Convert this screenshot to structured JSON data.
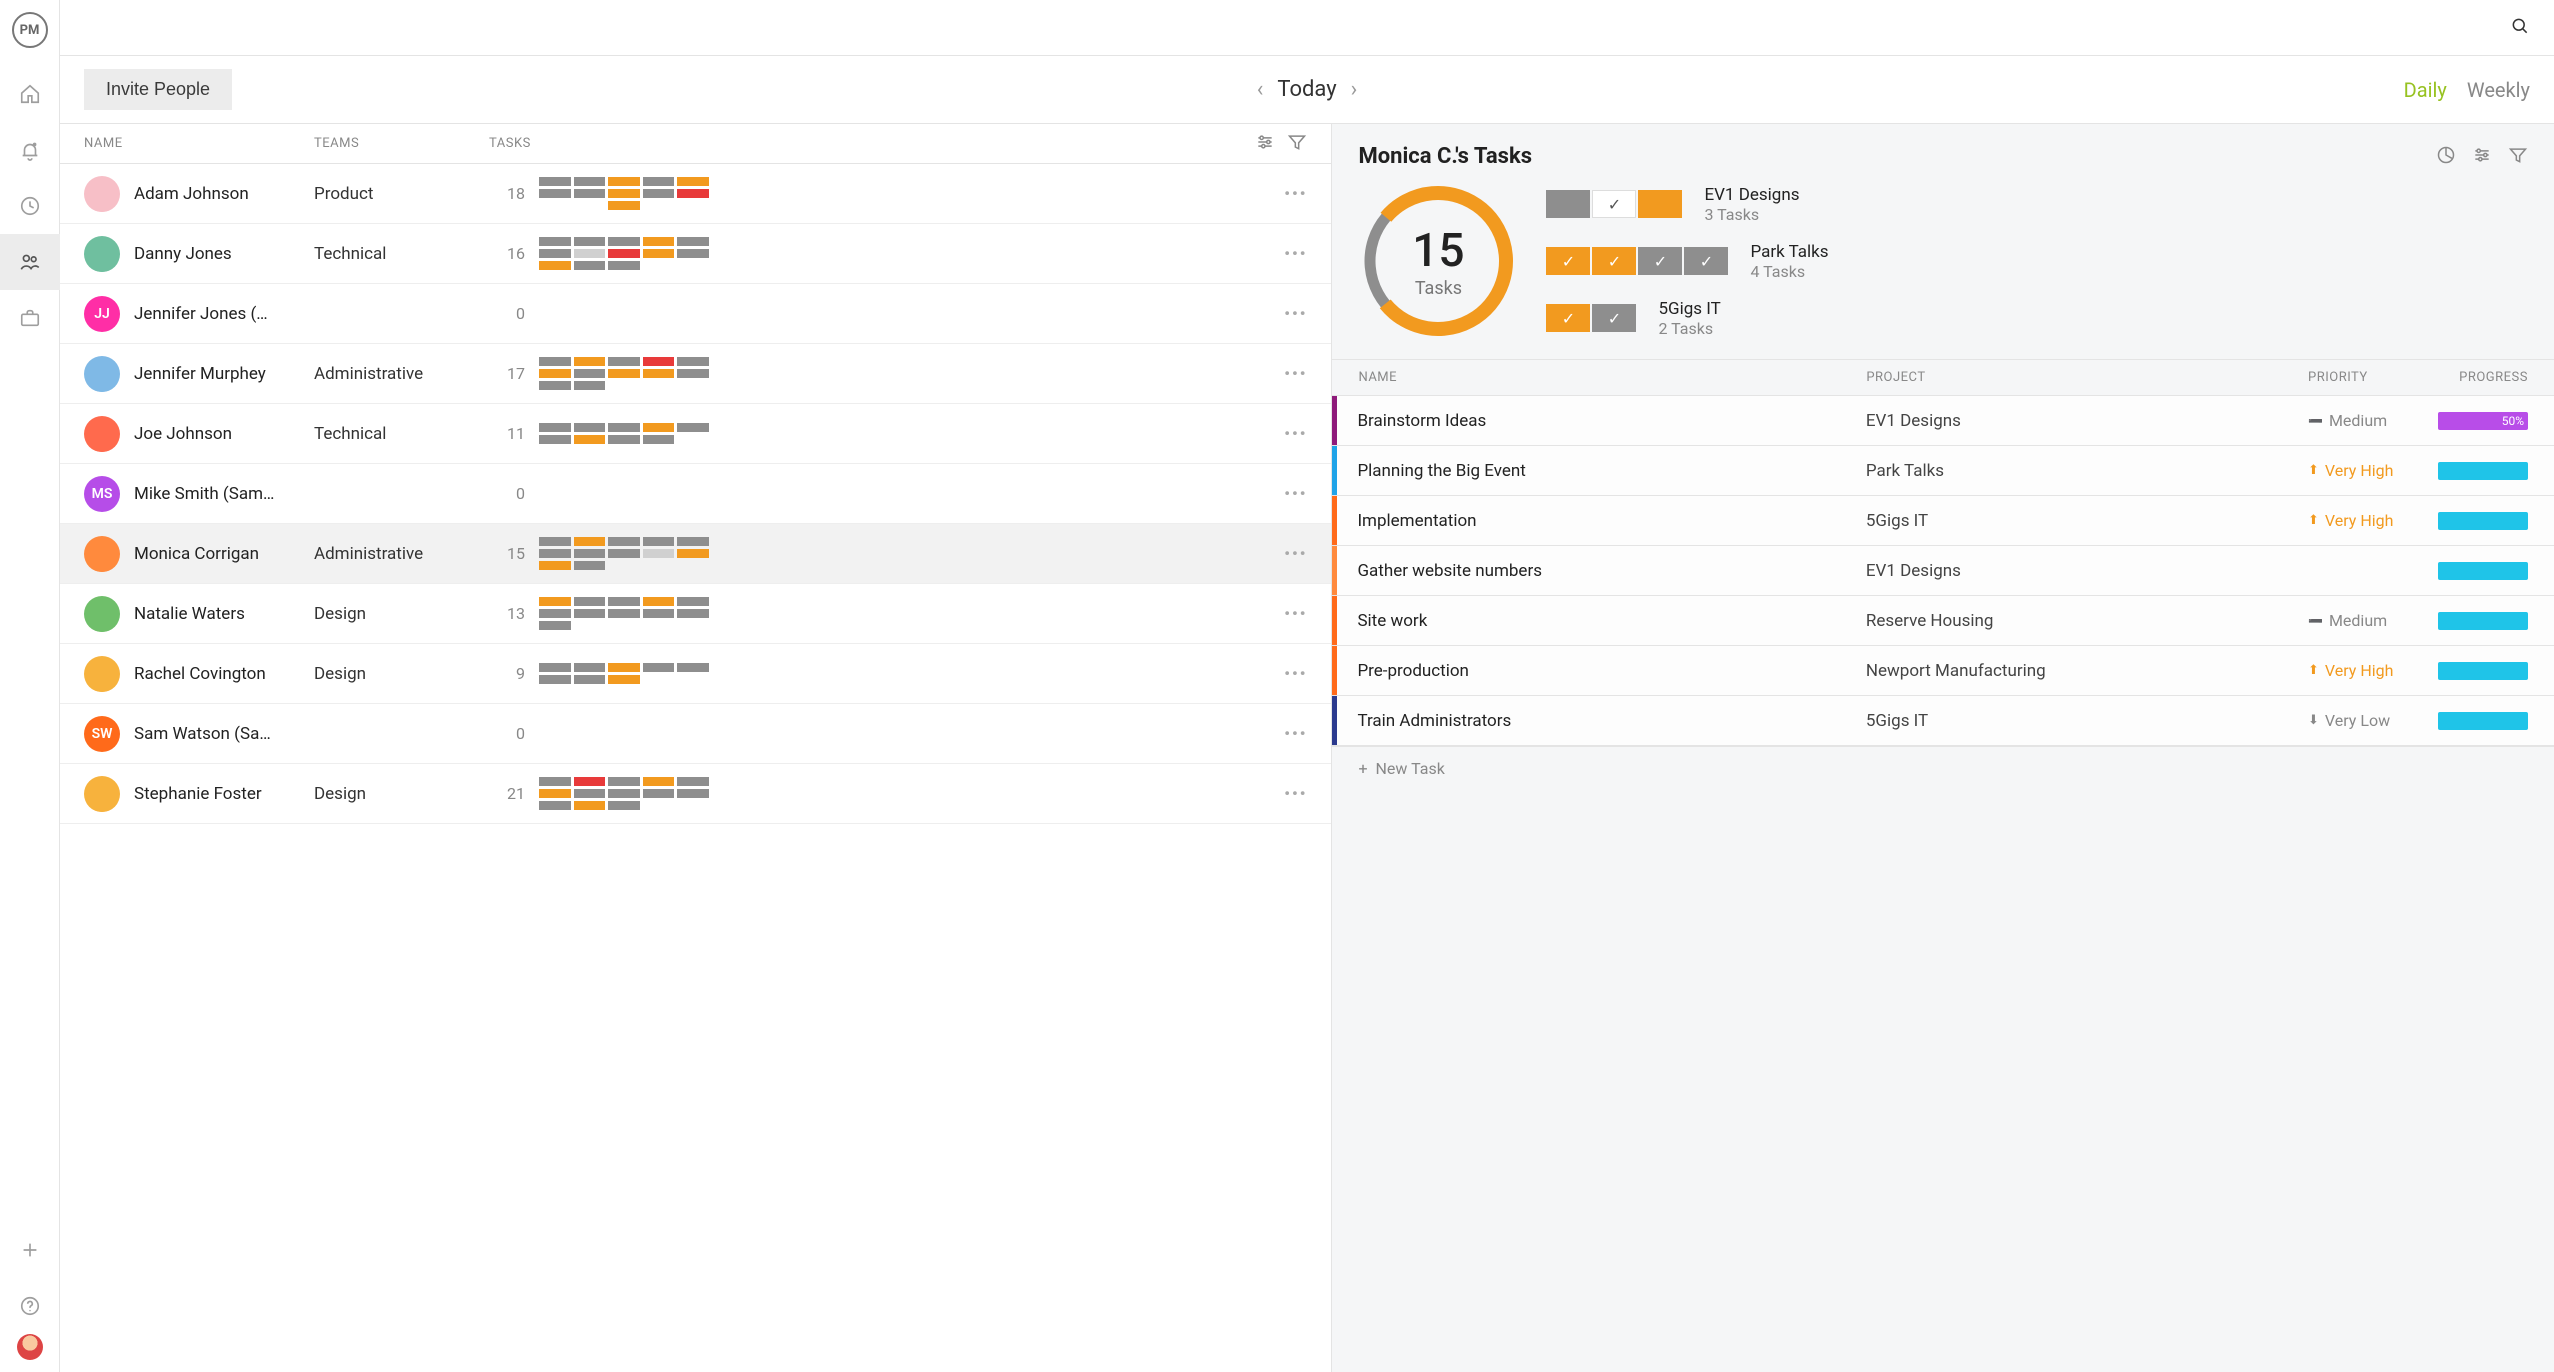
{
  "brand": "PM",
  "header": {
    "invite_label": "Invite People",
    "today_label": "Today",
    "daily_label": "Daily",
    "weekly_label": "Weekly"
  },
  "columns": {
    "name": "NAME",
    "teams": "TEAMS",
    "tasks": "TASKS"
  },
  "people": [
    {
      "name": "Adam Johnson",
      "team": "Product",
      "count": 18,
      "avatar_bg": "#f7bfc7",
      "bars": [
        [
          "",
          "",
          "o",
          "",
          "o"
        ],
        [
          "",
          "",
          "o",
          "",
          "r"
        ],
        [
          "e",
          "e",
          "o",
          "e",
          "e"
        ]
      ]
    },
    {
      "name": "Danny Jones",
      "team": "Technical",
      "count": 16,
      "avatar_bg": "#6fbf9f",
      "bars": [
        [
          "",
          "",
          "",
          "o",
          ""
        ],
        [
          "",
          "g",
          "r",
          "o",
          ""
        ],
        [
          "o",
          "",
          "",
          "e",
          "e"
        ]
      ]
    },
    {
      "name": "Jennifer Jones (…",
      "team": "",
      "count": 0,
      "avatar_bg": "#ff2ea6",
      "initials": "JJ",
      "bars": []
    },
    {
      "name": "Jennifer Murphey",
      "team": "Administrative",
      "count": 17,
      "avatar_bg": "#7fb9e6",
      "bars": [
        [
          "",
          "o",
          "",
          "r",
          ""
        ],
        [
          "o",
          "",
          "o",
          "o",
          ""
        ],
        [
          "",
          "",
          "e",
          "e",
          "e"
        ]
      ]
    },
    {
      "name": "Joe Johnson",
      "team": "Technical",
      "count": 11,
      "avatar_bg": "#ff6a4d",
      "bars": [
        [
          "",
          "",
          "",
          "o",
          ""
        ],
        [
          "",
          "o",
          "",
          "",
          "e"
        ]
      ]
    },
    {
      "name": "Mike Smith (Sam…",
      "team": "",
      "count": 0,
      "avatar_bg": "#b64de8",
      "initials": "MS",
      "bars": []
    },
    {
      "name": "Monica Corrigan",
      "team": "Administrative",
      "count": 15,
      "avatar_bg": "#ff8a3d",
      "selected": true,
      "bars": [
        [
          "",
          "o",
          "",
          "",
          ""
        ],
        [
          "",
          "",
          "",
          "g",
          "o"
        ],
        [
          "o",
          "",
          "e",
          "e",
          "e"
        ]
      ]
    },
    {
      "name": "Natalie Waters",
      "team": "Design",
      "count": 13,
      "avatar_bg": "#6fbf6a",
      "bars": [
        [
          "o",
          "",
          "",
          "o",
          ""
        ],
        [
          "",
          "",
          "",
          "",
          ""
        ],
        [
          "",
          "e",
          "e",
          "e",
          "e"
        ]
      ]
    },
    {
      "name": "Rachel Covington",
      "team": "Design",
      "count": 9,
      "avatar_bg": "#f7b23d",
      "bars": [
        [
          "",
          "",
          "o",
          "",
          ""
        ],
        [
          "",
          "",
          "o",
          "e",
          "e"
        ]
      ]
    },
    {
      "name": "Sam Watson (Sa…",
      "team": "",
      "count": 0,
      "avatar_bg": "#ff6a1a",
      "initials": "SW",
      "bars": []
    },
    {
      "name": "Stephanie Foster",
      "team": "Design",
      "count": 21,
      "avatar_bg": "#f7b23d",
      "bars": [
        [
          "",
          "r",
          "",
          "o",
          ""
        ],
        [
          "o",
          "",
          "",
          "",
          ""
        ],
        [
          "",
          "o",
          "",
          "e",
          "e"
        ]
      ]
    }
  ],
  "detail": {
    "title": "Monica C.'s Tasks",
    "donut": {
      "value": 15,
      "label": "Tasks",
      "pct": 78
    },
    "projects": [
      {
        "name": "EV1 Designs",
        "tasks": "3 Tasks",
        "boxes": [
          {
            "c": "gray"
          },
          {
            "c": "wh",
            "ck": true
          },
          {
            "c": "or"
          }
        ]
      },
      {
        "name": "Park Talks",
        "tasks": "4 Tasks",
        "boxes": [
          {
            "c": "or",
            "ck": true
          },
          {
            "c": "or",
            "ck": true
          },
          {
            "c": "gray",
            "ck": true
          },
          {
            "c": "gray",
            "ck": true
          }
        ]
      },
      {
        "name": "5Gigs IT",
        "tasks": "2 Tasks",
        "boxes": [
          {
            "c": "or",
            "ck": true
          },
          {
            "c": "gray",
            "ck": true
          }
        ]
      }
    ],
    "task_headers": {
      "name": "NAME",
      "project": "PROJECT",
      "priority": "PRIORITY",
      "progress": "PROGRESS"
    },
    "tasks": [
      {
        "bar": "#8e1a7a",
        "name": "Brainstorm Ideas",
        "project": "EV1 Designs",
        "pri": "Medium",
        "pclass": "pri-med dash",
        "prog": "50%",
        "pcolor": "purple",
        "pwidth": "100%"
      },
      {
        "bar": "#1fa3e8",
        "name": "Planning the Big Event",
        "project": "Park Talks",
        "pri": "Very High",
        "pclass": "pri-vh arrow-up",
        "prog": "",
        "pwidth": "100%"
      },
      {
        "bar": "#ff6a1a",
        "name": "Implementation",
        "project": "5Gigs IT",
        "pri": "Very High",
        "pclass": "pri-vh arrow-up",
        "prog": "",
        "pwidth": "100%"
      },
      {
        "bar": "#ff8a3d",
        "name": "Gather website numbers",
        "project": "EV1 Designs",
        "pri": "",
        "pclass": "",
        "prog": "",
        "pwidth": "100%"
      },
      {
        "bar": "#ff6a1a",
        "name": "Site work",
        "project": "Reserve Housing",
        "pri": "Medium",
        "pclass": "pri-med dash",
        "prog": "",
        "pwidth": "100%"
      },
      {
        "bar": "#ff6a1a",
        "name": "Pre-production",
        "project": "Newport Manufacturing",
        "pri": "Very High",
        "pclass": "pri-vh arrow-up",
        "prog": "",
        "pwidth": "100%"
      },
      {
        "bar": "#2b3a8e",
        "name": "Train Administrators",
        "project": "5Gigs IT",
        "pri": "Very Low",
        "pclass": "pri-vl arrow-down",
        "prog": "",
        "pwidth": "100%"
      }
    ],
    "new_task_label": "New Task"
  }
}
